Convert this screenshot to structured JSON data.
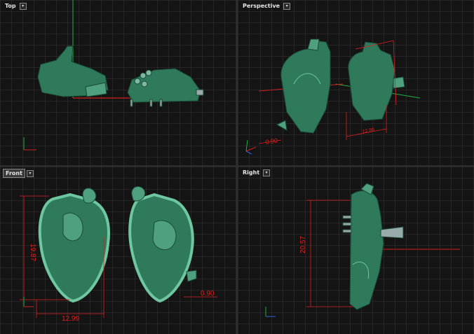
{
  "viewports": {
    "top": {
      "label": "Top"
    },
    "perspective": {
      "label": "Perspective",
      "dim_width": "12.99",
      "dim_small": "0.90"
    },
    "front": {
      "label": "Front",
      "dim_height": "19.87",
      "dim_width": "12.99",
      "dim_small": "0.90"
    },
    "right": {
      "label": "Right",
      "dim_height": "20.57"
    }
  },
  "colors": {
    "model": "#2f7a5a",
    "model_light": "#6ec7a0",
    "dimension": "#e01e1e",
    "axis_x": "#d02020",
    "axis_y": "#20b040"
  },
  "icons": {
    "dropdown": "chevron-down-icon",
    "axis": "axis-triad-icon"
  }
}
